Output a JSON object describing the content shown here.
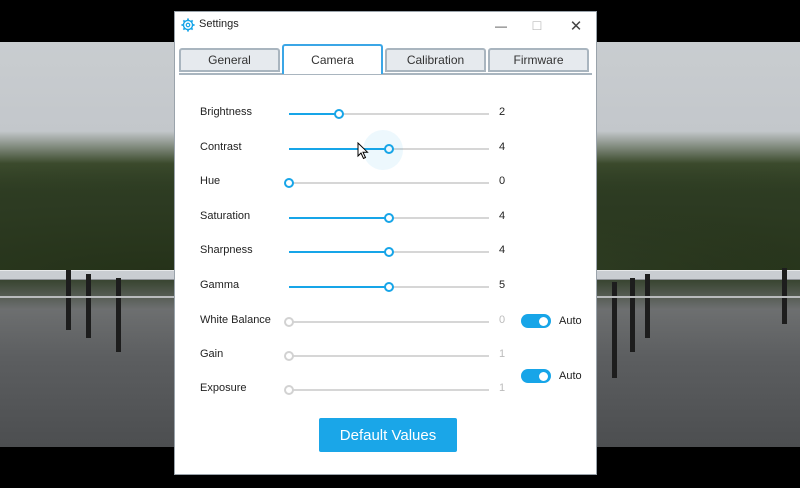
{
  "window": {
    "title": "Settings",
    "minimize_glyph": "—",
    "maximize_glyph": "☐",
    "close_glyph": "✕",
    "icon": "gear-icon"
  },
  "tabs": [
    {
      "label": "General",
      "active": false
    },
    {
      "label": "Camera",
      "active": true
    },
    {
      "label": "Calibration",
      "active": false
    },
    {
      "label": "Firmware",
      "active": false
    }
  ],
  "sliders": [
    {
      "label": "Brightness",
      "value": "2",
      "fraction": 0.25,
      "enabled": true
    },
    {
      "label": "Contrast",
      "value": "4",
      "fraction": 0.5,
      "enabled": true
    },
    {
      "label": "Hue",
      "value": "0",
      "fraction": 0.0,
      "enabled": true
    },
    {
      "label": "Saturation",
      "value": "4",
      "fraction": 0.5,
      "enabled": true
    },
    {
      "label": "Sharpness",
      "value": "4",
      "fraction": 0.5,
      "enabled": true
    },
    {
      "label": "Gamma",
      "value": "5",
      "fraction": 0.5,
      "enabled": true
    },
    {
      "label": "White Balance",
      "value": "0",
      "fraction": 0.0,
      "enabled": false
    },
    {
      "label": "Gain",
      "value": "1",
      "fraction": 0.0,
      "enabled": false
    },
    {
      "label": "Exposure",
      "value": "1",
      "fraction": 0.0,
      "enabled": false
    }
  ],
  "toggles": [
    {
      "label": "Auto",
      "on": true
    },
    {
      "label": "Auto",
      "on": true
    }
  ],
  "default_button": "Default Values",
  "colors": {
    "accent": "#17a5e8",
    "button": "#1aa6e8",
    "tab_border": "#a9b5bf"
  }
}
